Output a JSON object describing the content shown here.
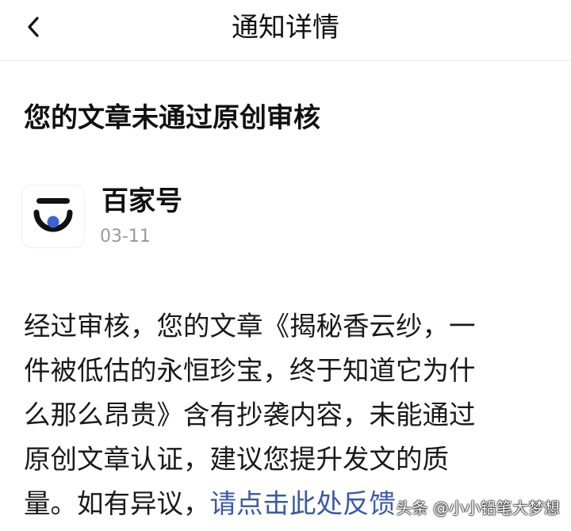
{
  "header": {
    "back_icon": "chevron-left-icon",
    "title": "通知详情"
  },
  "notice": {
    "title": "您的文章未通过原创审核"
  },
  "sender": {
    "name": "百家号",
    "date": "03-11",
    "logo_colors": {
      "ring": "#111111",
      "dot": "#3d62d6"
    }
  },
  "body": {
    "lines": [
      "经过审核，您的文章《揭秘香云纱，一",
      "件被低估的永恒珍宝，终于知道它为什",
      "么那么昂贵》含有抄袭内容，未能通过",
      "原创文章认证，建议您提升发文的质",
      "量。如有异议，"
    ],
    "link_text": "请点击此处反馈",
    "link_color": "#3a59a8"
  },
  "watermark": {
    "text": "头条 @小小铅笔大梦想"
  }
}
